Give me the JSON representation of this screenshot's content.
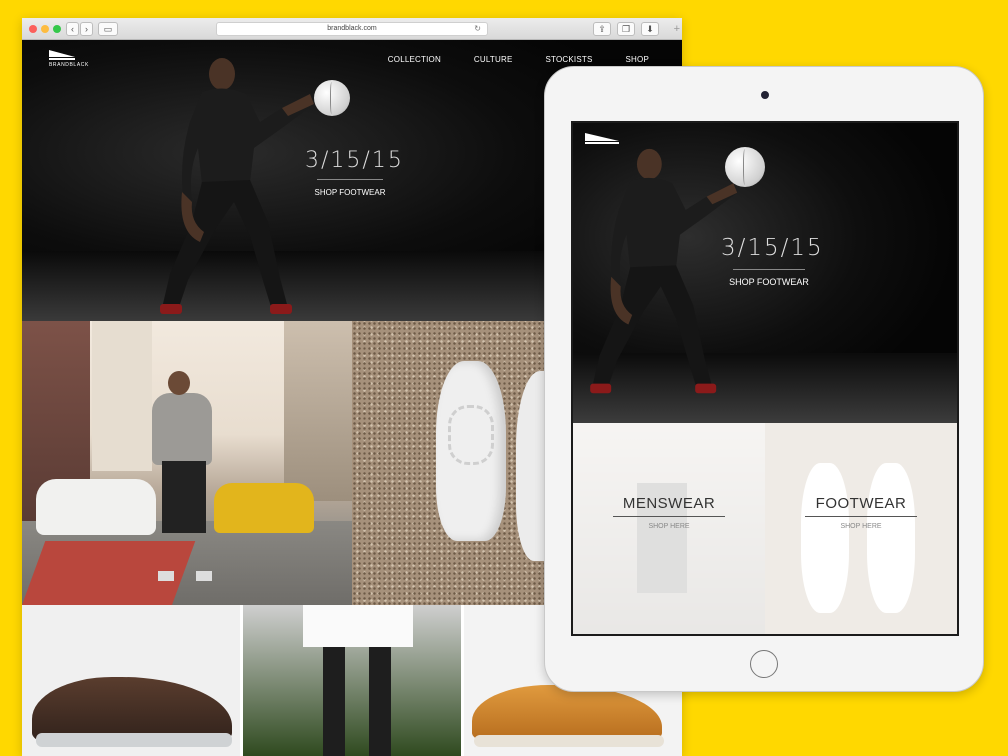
{
  "browser": {
    "url": "brandblack.com",
    "nav_back": "‹",
    "nav_forward": "›"
  },
  "site": {
    "logo_text": "BRANDBLACK",
    "nav": [
      "COLLECTION",
      "CULTURE",
      "STOCKISTS",
      "SHOP"
    ],
    "hero": {
      "date": "3/15/15",
      "cta": "SHOP FOOTWEAR"
    }
  },
  "tablet": {
    "hero": {
      "date": "3/15/15",
      "cta": "SHOP FOOTWEAR"
    },
    "panels": [
      {
        "title": "MENSWEAR",
        "cta": "SHOP HERE"
      },
      {
        "title": "FOOTWEAR",
        "cta": "SHOP HERE"
      }
    ]
  },
  "colors": {
    "background": "#FFD800",
    "hero_bg": "#050505"
  }
}
